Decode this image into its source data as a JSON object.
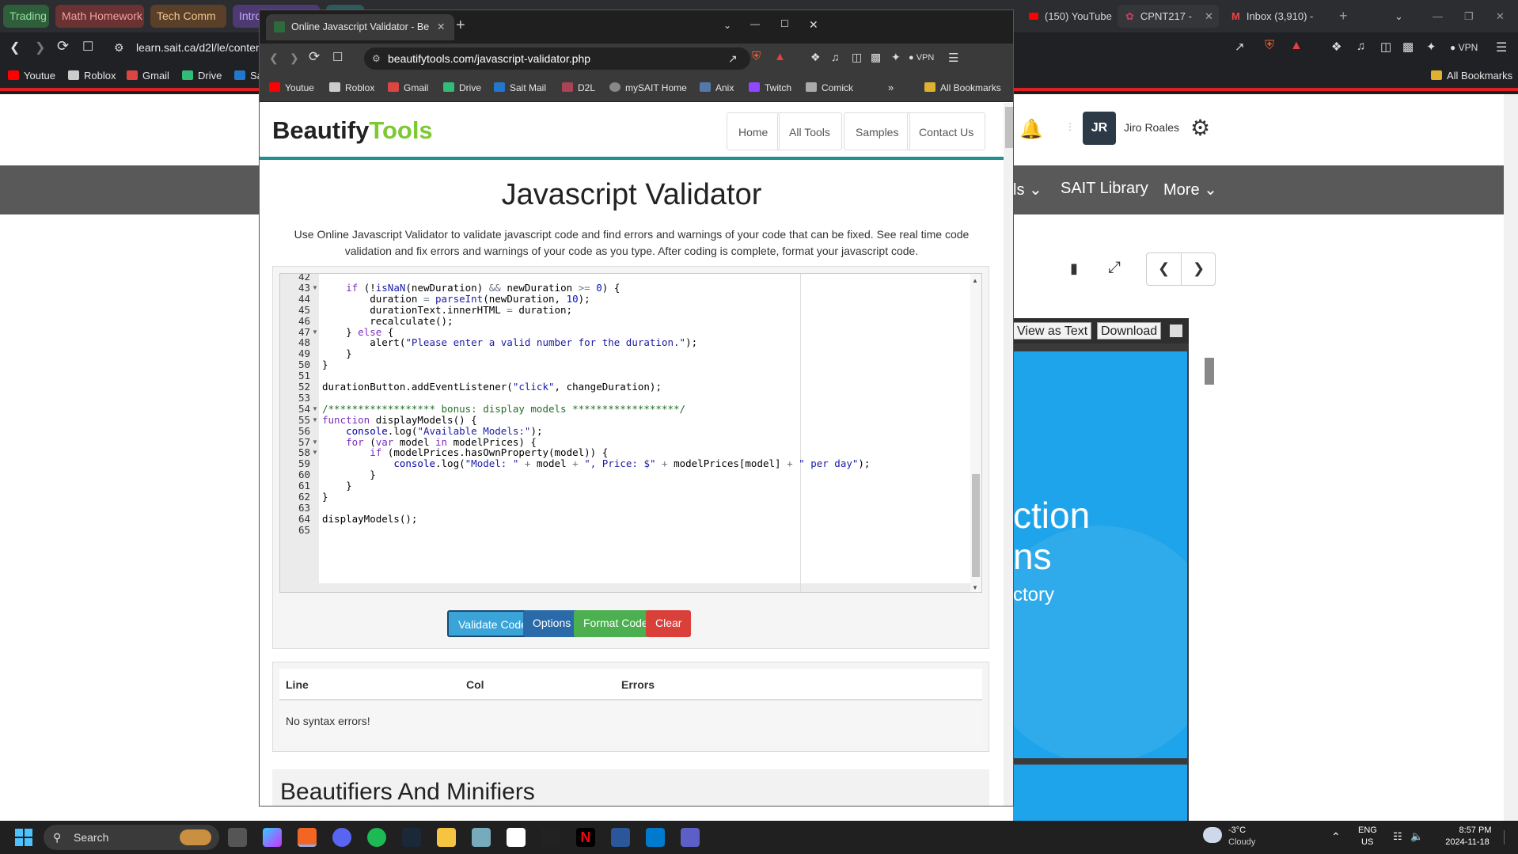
{
  "bg_browser": {
    "tabs": [
      "Trading",
      "Math Homework",
      "Tech Comm",
      "Intro"
    ],
    "right_tabs": [
      "(150) YouTube",
      "CPNT217 -",
      "Inbox (3,910) -"
    ],
    "url": "learn.sait.ca/d2l/le/conten",
    "bookmarks": [
      "Youtue",
      "Roblox",
      "Gmail",
      "Drive",
      "Sa"
    ],
    "right_bookmarks": "All Bookmarks",
    "vpn": "VPN",
    "user_initials": "JR",
    "user_name": "Jiro Roales",
    "nav_items": [
      "ls",
      "SAIT Library",
      "More"
    ],
    "pdf_buttons": [
      "View as Text",
      "Download"
    ],
    "pdf_text": [
      "ction",
      "ns",
      "ctory"
    ]
  },
  "window": {
    "tab_title": "Online Javascript Validator - Be",
    "url": "beautifytools.com/javascript-validator.php",
    "vpn": "VPN",
    "bookmarks": [
      "Youtue",
      "Roblox",
      "Gmail",
      "Drive",
      "Sait Mail",
      "D2L",
      "mySAIT Home",
      "Anix",
      "Twitch",
      "Comick"
    ],
    "all_bookmarks": "All Bookmarks"
  },
  "site": {
    "logo_a": "Beautify",
    "logo_b": "Tools",
    "nav": [
      "Home",
      "All Tools",
      "Samples",
      "Contact Us"
    ],
    "title": "Javascript Validator",
    "description": "Use Online Javascript Validator to validate javascript code and find errors and warnings of your code that can be fixed. See real time code validation and fix errors and warnings of your code as you type. After coding is complete, format your javascript code.",
    "buttons": [
      "Validate Code",
      "Options",
      "Format Code",
      "Clear"
    ],
    "results_headers": [
      "Line",
      "Col",
      "Errors"
    ],
    "results_message": "No syntax errors!",
    "section_title": "Beautifiers And Minifiers"
  },
  "editor": {
    "lines": [
      {
        "n": "42",
        "code": ""
      },
      {
        "n": "43",
        "code": "    if (!isNaN(newDuration) && newDuration >= 0) {",
        "fold": true
      },
      {
        "n": "44",
        "code": "        duration = parseInt(newDuration, 10);"
      },
      {
        "n": "45",
        "code": "        durationText.innerHTML = duration;"
      },
      {
        "n": "46",
        "code": "        recalculate();"
      },
      {
        "n": "47",
        "code": "    } else {",
        "fold": true
      },
      {
        "n": "48",
        "code": "        alert(\"Please enter a valid number for the duration.\");"
      },
      {
        "n": "49",
        "code": "    }"
      },
      {
        "n": "50",
        "code": "}"
      },
      {
        "n": "51",
        "code": ""
      },
      {
        "n": "52",
        "code": "durationButton.addEventListener(\"click\", changeDuration);"
      },
      {
        "n": "53",
        "code": ""
      },
      {
        "n": "54",
        "code": "/****************** bonus: display models ******************/",
        "fold": true
      },
      {
        "n": "55",
        "code": "function displayModels() {",
        "fold": true
      },
      {
        "n": "56",
        "code": "    console.log(\"Available Models:\");"
      },
      {
        "n": "57",
        "code": "    for (var model in modelPrices) {",
        "fold": true
      },
      {
        "n": "58",
        "code": "        if (modelPrices.hasOwnProperty(model)) {",
        "fold": true
      },
      {
        "n": "59",
        "code": "            console.log(\"Model: \" + model + \", Price: $\" + modelPrices[model] + \" per day\");"
      },
      {
        "n": "60",
        "code": "        }"
      },
      {
        "n": "61",
        "code": "    }"
      },
      {
        "n": "62",
        "code": "}"
      },
      {
        "n": "63",
        "code": ""
      },
      {
        "n": "64",
        "code": "displayModels();"
      },
      {
        "n": "65",
        "code": ""
      }
    ]
  },
  "taskbar": {
    "search": "Search",
    "weather_temp": "-3°C",
    "weather_desc": "Cloudy",
    "lang1": "ENG",
    "lang2": "US",
    "time": "8:57 PM",
    "date": "2024-11-18"
  },
  "colors": {
    "validate": "#3aa4d8",
    "options": "#2a6aa8",
    "format": "#4caf50",
    "clear": "#d9403a",
    "accent": "#1f8f8f"
  }
}
